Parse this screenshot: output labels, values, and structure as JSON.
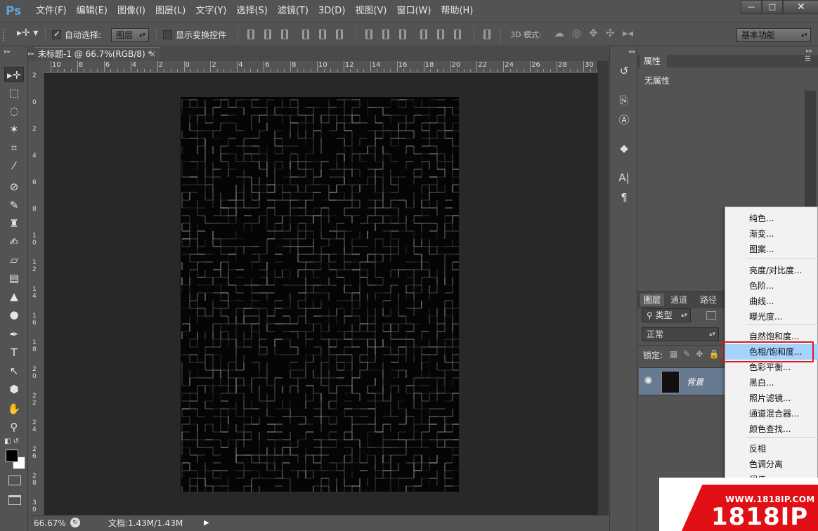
{
  "app": {
    "logo": "Ps"
  },
  "menu": [
    "文件(F)",
    "编辑(E)",
    "图像(I)",
    "图层(L)",
    "文字(Y)",
    "选择(S)",
    "滤镜(T)",
    "3D(D)",
    "视图(V)",
    "窗口(W)",
    "帮助(H)"
  ],
  "window_controls": {
    "minimize": "—",
    "maximize": "□",
    "close": "✕"
  },
  "options": {
    "auto_select_label": "自动选择:",
    "auto_select_checked": true,
    "auto_select_value": "图层",
    "show_transform_label": "显示变换控件",
    "show_transform_checked": false,
    "mode_3d_label": "3D 模式:",
    "workspace": "基本功能"
  },
  "document": {
    "tab_title": "未标题-1 @ 66.7%(RGB/8) *",
    "zoom": "66.67%",
    "doc_size": "文档:1.43M/1.43M"
  },
  "ruler": {
    "h_labels": [
      "10",
      "8",
      "6",
      "4",
      "2",
      "0",
      "2",
      "4",
      "6",
      "8",
      "10",
      "12",
      "14",
      "16",
      "18",
      "20",
      "22",
      "24",
      "26",
      "28",
      "30"
    ],
    "v_labels": [
      "2",
      "0",
      "2",
      "4",
      "6",
      "8",
      "10",
      "12",
      "14",
      "16",
      "18",
      "20",
      "22",
      "24",
      "26",
      "28",
      "30"
    ]
  },
  "tools": [
    {
      "name": "move-tool-icon",
      "glyph": "▸✛"
    },
    {
      "name": "marquee-tool-icon",
      "glyph": "⬚"
    },
    {
      "name": "lasso-tool-icon",
      "glyph": "◌"
    },
    {
      "name": "magic-wand-tool-icon",
      "glyph": "✶"
    },
    {
      "name": "crop-tool-icon",
      "glyph": "⌗"
    },
    {
      "name": "eyedropper-tool-icon",
      "glyph": "⁄"
    },
    {
      "name": "healing-brush-tool-icon",
      "glyph": "⊘"
    },
    {
      "name": "brush-tool-icon",
      "glyph": "✎"
    },
    {
      "name": "clone-stamp-tool-icon",
      "glyph": "♜"
    },
    {
      "name": "history-brush-tool-icon",
      "glyph": "✍"
    },
    {
      "name": "eraser-tool-icon",
      "glyph": "▱"
    },
    {
      "name": "gradient-tool-icon",
      "glyph": "▤"
    },
    {
      "name": "blur-tool-icon",
      "glyph": "▲"
    },
    {
      "name": "dodge-tool-icon",
      "glyph": "●"
    },
    {
      "name": "pen-tool-icon",
      "glyph": "✒"
    },
    {
      "name": "type-tool-icon",
      "glyph": "T"
    },
    {
      "name": "path-selection-tool-icon",
      "glyph": "↖"
    },
    {
      "name": "shape-tool-icon",
      "glyph": "⬢"
    },
    {
      "name": "hand-tool-icon",
      "glyph": "✋"
    },
    {
      "name": "zoom-tool-icon",
      "glyph": "⚲"
    }
  ],
  "dock_icons": [
    {
      "name": "history-panel-icon",
      "glyph": "↺"
    },
    {
      "name": "clone-source-panel-icon",
      "glyph": "⎘"
    },
    {
      "name": "character-style-panel-icon",
      "glyph": "Ⓐ"
    },
    {
      "name": "3d-panel-icon",
      "glyph": "◆"
    },
    {
      "name": "character-panel-icon",
      "glyph": "A|"
    },
    {
      "name": "paragraph-panel-icon",
      "glyph": "¶"
    }
  ],
  "properties": {
    "tab": "属性",
    "body": "无属性"
  },
  "layers": {
    "tabs": [
      "图层",
      "通道",
      "路径"
    ],
    "filter_label": "类型",
    "blend_mode": "正常",
    "lock_label": "锁定:",
    "layer_name": "背景"
  },
  "context_menu": {
    "items": [
      "纯色...",
      "渐变...",
      "图案...",
      "亮度/对比度...",
      "色阶...",
      "曲线...",
      "曝光度...",
      "自然饱和度...",
      "色相/饱和度...",
      "色彩平衡...",
      "黑白...",
      "照片滤镜...",
      "通道混合器...",
      "颜色查找...",
      "反相",
      "色调分离",
      "阈值"
    ],
    "highlighted": "色相/饱和度..."
  },
  "watermark": {
    "url": "WWW.1818IP.COM",
    "brand": "1818IP"
  },
  "colors": {
    "accent_red": "#e10f16",
    "highlight": "#a6d2ff",
    "ps_blue": "#5fa3dd"
  }
}
